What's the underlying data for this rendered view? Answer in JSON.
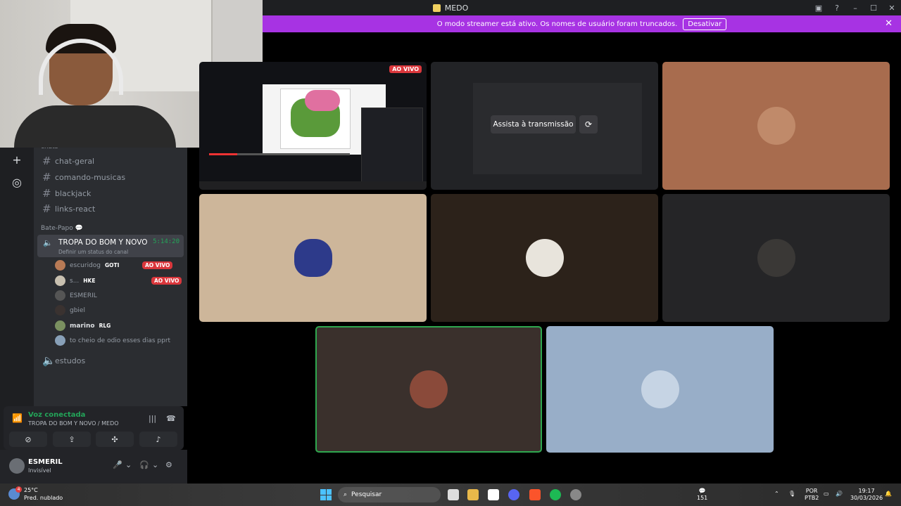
{
  "window": {
    "title": "MEDO"
  },
  "banner": {
    "message": "O modo streamer está ativo. Os nomes de usuário foram truncados.",
    "button": "Desativar"
  },
  "sidebar": {
    "category_top": "chats",
    "text_channels": [
      "chat-geral",
      "comando-musicas",
      "blackjack",
      "links-react"
    ],
    "category_voice": "Bate-Papo",
    "active_voice": {
      "name": "TROPA DO BOM Y NOVO",
      "timer": "5:14:20",
      "status": "Definir um status do canal"
    },
    "members": [
      {
        "name": "escuridog",
        "tag": "GOTI",
        "live": "AO VIVO",
        "color": "#b87a55"
      },
      {
        "name": "s...",
        "tag": "HKE",
        "live": "AO VIVO",
        "color": "#c8c0b0"
      },
      {
        "name": "ESMERIL",
        "tag": "",
        "live": "",
        "color": "#555"
      },
      {
        "name": "gbiel",
        "tag": "",
        "live": "",
        "color": "#3a3230"
      },
      {
        "name": "marino",
        "tag": "RLG",
        "live": "",
        "color": "#7a9060"
      },
      {
        "name": "to cheio de odio esses dias pprt",
        "tag": "",
        "live": "",
        "color": "#88a0b8"
      }
    ],
    "other_voice": "estudos"
  },
  "voice_panel": {
    "title": "Voz conectada",
    "subtitle": "TROPA DO BOM Y NOVO / MEDO"
  },
  "user": {
    "name": "ESMERIL",
    "status": "Invisível"
  },
  "stream": {
    "live_label": "AO VIVO",
    "watch_label": "Assista à transmissão"
  },
  "taskbar": {
    "weather_temp": "25°C",
    "weather_desc": "Pred. nublado",
    "search_placeholder": "Pesquisar",
    "lang_top": "POR",
    "lang_bottom": "PTB2",
    "time": "19:17",
    "date": "30/03/2026",
    "chat_count": "151",
    "weather_badge": "4"
  }
}
